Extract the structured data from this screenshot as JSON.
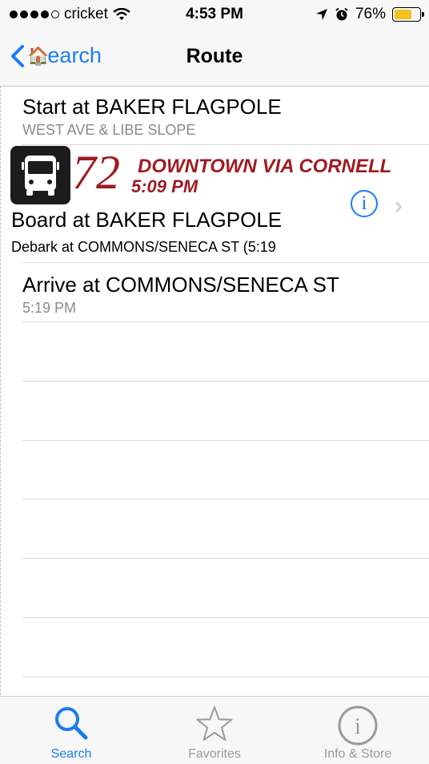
{
  "status_bar": {
    "carrier": "cricket",
    "time": "4:53 PM",
    "battery": "76%",
    "battery_level": 0.76
  },
  "nav": {
    "back_label": "Search",
    "back_label_visible": "earch",
    "title": "Route"
  },
  "start": {
    "title": "Start at BAKER FLAGPOLE",
    "subtitle": "WEST AVE & LIBE SLOPE"
  },
  "route": {
    "number": "72",
    "name": "DOWNTOWN VIA CORNELL",
    "time": "5:09 PM",
    "board": "Board at BAKER FLAGPOLE",
    "debark": "Debark at COMMONS/SENECA ST (5:19"
  },
  "arrive": {
    "title": "Arrive at COMMONS/SENECA ST",
    "time": "5:19 PM"
  },
  "tabs": [
    {
      "label": "Search",
      "icon": "search-icon",
      "active": true
    },
    {
      "label": "Favorites",
      "icon": "star-icon",
      "active": false
    },
    {
      "label": "Info & Store",
      "icon": "info-icon",
      "active": false
    }
  ],
  "colors": {
    "accent": "#1a7cf5",
    "route": "#9e1b23"
  }
}
